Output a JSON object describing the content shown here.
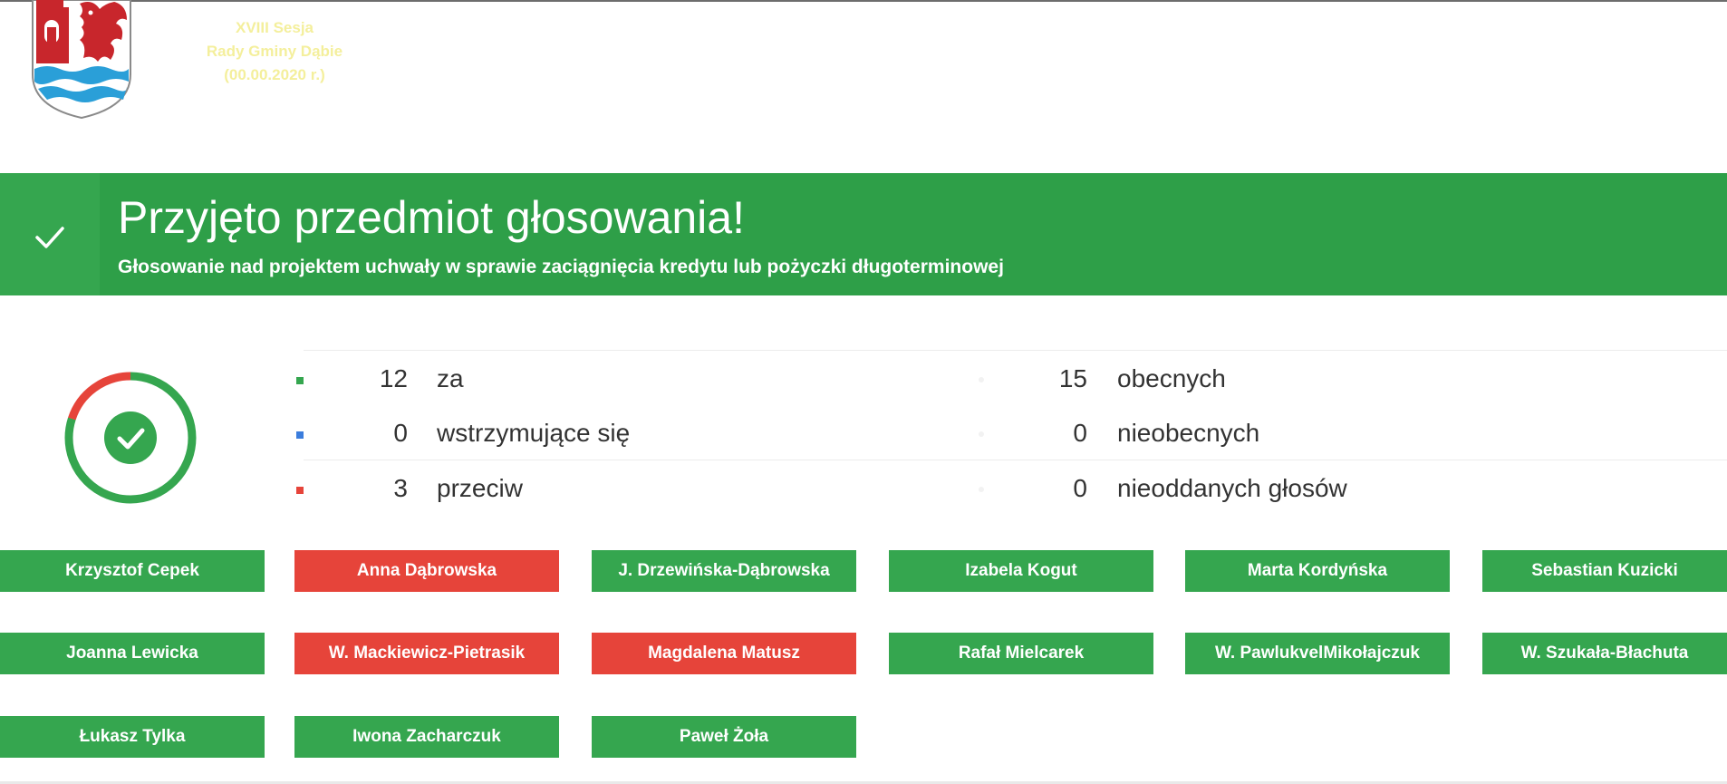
{
  "header": {
    "session_info": [
      "XVIII Sesja",
      "Rady Gminy Dąbie",
      "(00.00.2020 r.)"
    ],
    "colors": {
      "crest_red": "#c8262c",
      "crest_blue": "#2a9fd8",
      "session_text": "#f4ef9c"
    }
  },
  "result": {
    "title": "Przyjęto przedmiot głosowania!",
    "subtitle": "Głosowanie nad projektem uchwały w sprawie zaciągnięcia kredytu lub pożyczki długoterminowej",
    "icon": "check-icon",
    "color": "#2e9f48"
  },
  "donut": {
    "for_fraction": 0.8,
    "against_fraction": 0.2,
    "colors": {
      "for": "#35a64f",
      "against": "#e6443a"
    },
    "icon": "check-circle-icon"
  },
  "stats": {
    "rows": [
      {
        "count": "12",
        "label": "za",
        "color": "#35a64f",
        "count_right": "15",
        "label_right": "obecnych"
      },
      {
        "count": "0",
        "label": "wstrzymujące się",
        "color": "#3b7ddd",
        "count_right": "0",
        "label_right": "nieobecnych"
      },
      {
        "count": "3",
        "label": "przeciw",
        "color": "#e6443a",
        "count_right": "0",
        "label_right": "nieoddanych głosów"
      }
    ]
  },
  "members": [
    {
      "name": "Krzysztof Cepek",
      "vote": "za"
    },
    {
      "name": "Anna Dąbrowska",
      "vote": "przeciw"
    },
    {
      "name": "J. Drzewińska-Dąbrowska",
      "vote": "za"
    },
    {
      "name": "Izabela Kogut",
      "vote": "za"
    },
    {
      "name": "Marta Kordyńska",
      "vote": "za"
    },
    {
      "name": "Sebastian Kuzicki",
      "vote": "za"
    },
    {
      "name": "Joanna Lewicka",
      "vote": "za"
    },
    {
      "name": "W. Mackiewicz-Pietrasik",
      "vote": "przeciw"
    },
    {
      "name": "Magdalena Matusz",
      "vote": "przeciw"
    },
    {
      "name": "Rafał Mielcarek",
      "vote": "za"
    },
    {
      "name": "W. PawlukvelMikołajczuk",
      "vote": "za"
    },
    {
      "name": "W. Szukała-Błachuta",
      "vote": "za"
    },
    {
      "name": "Łukasz Tylka",
      "vote": "za"
    },
    {
      "name": "Iwona Zacharczuk",
      "vote": "za"
    },
    {
      "name": "Paweł Żoła",
      "vote": "za"
    }
  ]
}
